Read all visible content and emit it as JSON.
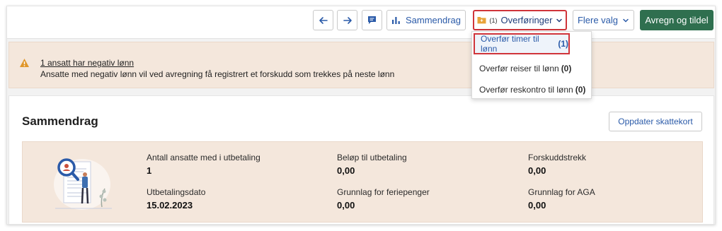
{
  "toolbar": {
    "prev_icon": "arrow-left-icon",
    "next_icon": "arrow-right-icon",
    "comment_icon": "comment-icon",
    "summary_label": "Sammendrag",
    "summary_icon": "bar-chart-icon",
    "transfers_count": "(1)",
    "transfers_label": "Overføringer",
    "transfers_icon": "folder-icon",
    "more_label": "Flere valg",
    "settle_label": "Avregn og tildel"
  },
  "dropdown": {
    "items": [
      {
        "label": "Overfør timer til lønn",
        "count": "(1)"
      },
      {
        "label": "Overfør reiser til lønn",
        "count": "(0)"
      },
      {
        "label": "Overfør reskontro til lønn",
        "count": "(0)"
      }
    ]
  },
  "warning": {
    "icon": "warning-triangle-icon",
    "title": "1 ansatt har negativ lønn",
    "text": "Ansatte med negativ lønn vil ved avregning få registrert et forskudd som trekkes på neste lønn"
  },
  "summary": {
    "title": "Sammendrag",
    "refresh_label": "Oppdater skattekort",
    "stats": [
      {
        "label": "Antall ansatte med i utbetaling",
        "value": "1"
      },
      {
        "label": "Beløp til utbetaling",
        "value": "0,00"
      },
      {
        "label": "Forskuddstrekk",
        "value": "0,00"
      },
      {
        "label": "Utbetalingsdato",
        "value": "15.02.2023"
      },
      {
        "label": "Grunnlag for feriepenger",
        "value": "0,00"
      },
      {
        "label": "Grunnlag for AGA",
        "value": "0,00"
      }
    ]
  },
  "colors": {
    "accent": "#2a5aa8",
    "primary_button": "#2f6f4f",
    "highlight_border": "#d0343a",
    "warning_bg": "#f4e7dc"
  }
}
